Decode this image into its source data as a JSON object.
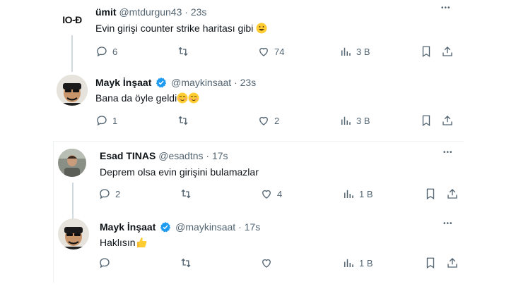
{
  "tweets": [
    {
      "name": "ümit",
      "handle": "@mtdurgun43",
      "time": "23s",
      "text": "Evin girişi counter strike haritası gibi",
      "avatar_text": "IO-Ð",
      "replies": "6",
      "retweets": "",
      "likes": "74",
      "views": "3 B",
      "verified": false
    },
    {
      "name": "Mayk İnşaat",
      "handle": "@maykinsaat",
      "time": "23s",
      "text": "Bana da öyle geldi",
      "replies": "1",
      "retweets": "",
      "likes": "2",
      "views": "3 B",
      "verified": true
    },
    {
      "name": "Esad TINAS",
      "handle": "@esadtns",
      "time": "17s",
      "text": "Deprem olsa evin girişini bulamazlar",
      "replies": "2",
      "retweets": "",
      "likes": "4",
      "views": "1 B",
      "verified": false
    },
    {
      "name": "Mayk İnşaat",
      "handle": "@maykinsaat",
      "time": "17s",
      "text": "Haklısın",
      "replies": "",
      "retweets": "",
      "likes": "",
      "views": "1 B",
      "verified": true
    }
  ],
  "ui": {
    "separator": "·",
    "more": "•••"
  },
  "colors": {
    "verified_blue": "#1d9bf0",
    "icon_gray": "#536471",
    "thread_line": "#cfd9de"
  }
}
